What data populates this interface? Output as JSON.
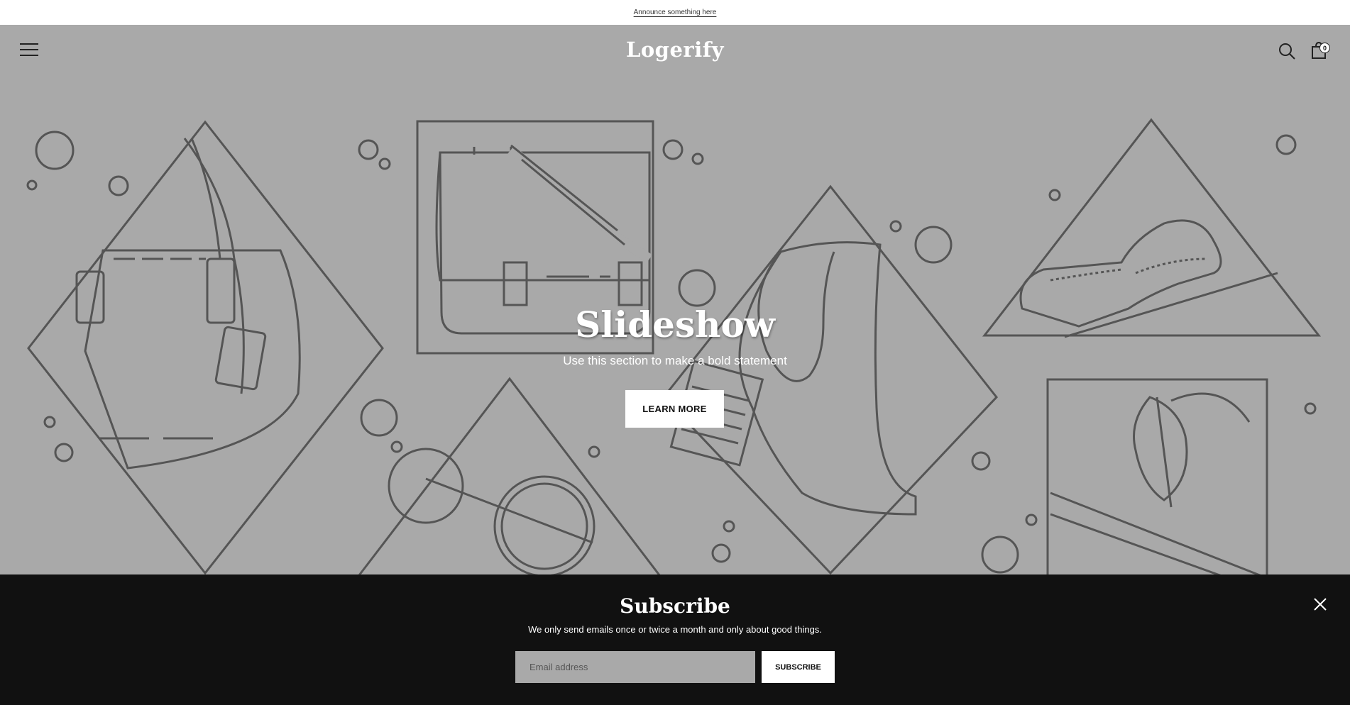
{
  "announcement": {
    "text": "Announce something here"
  },
  "header": {
    "logo": "Logerify",
    "cart_count": "0",
    "menu_icon": "hamburger-menu-icon",
    "search_icon": "search-icon",
    "cart_icon": "shopping-bag-icon"
  },
  "slideshow": {
    "title": "Slideshow",
    "subtitle": "Use this section to make a bold statement",
    "button_label": "LEARN MORE"
  },
  "subscribe": {
    "title": "Subscribe",
    "text": "We only send emails once or twice a month and only about good things.",
    "email_placeholder": "Email address",
    "button_label": "SUBSCRIBE",
    "close_icon": "close-icon"
  },
  "colors": {
    "hero_background": "#a9a9a9",
    "line_art": "#555555",
    "subscribe_background": "#111111",
    "button_background": "#ffffff"
  }
}
